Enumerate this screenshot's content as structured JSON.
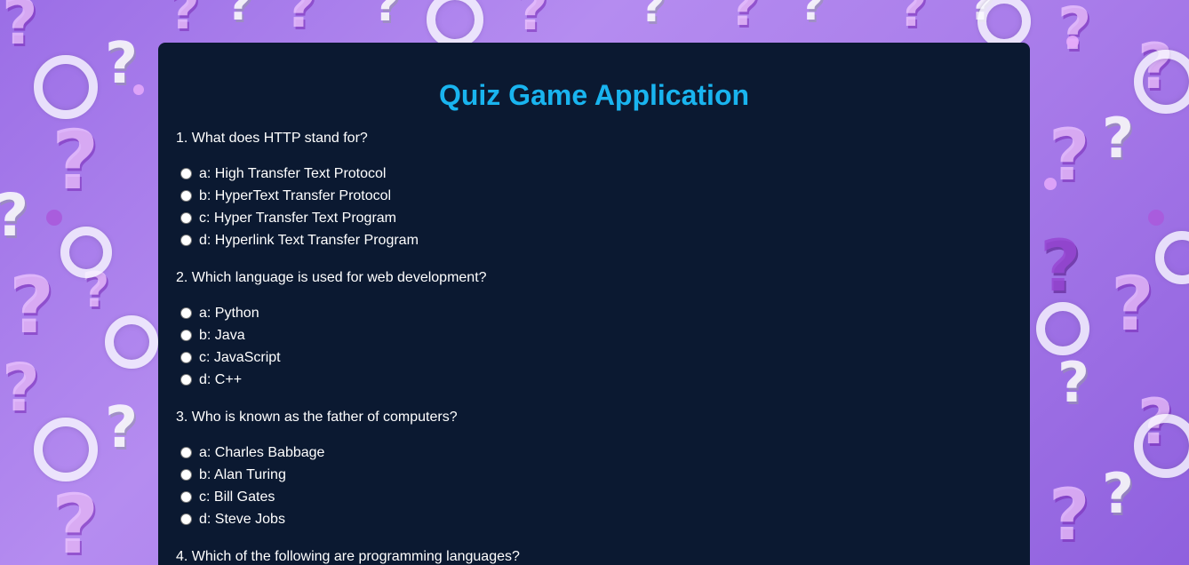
{
  "page": {
    "title": "Quiz Game Application",
    "title_color": "#19b4ef",
    "card_color": "#0b1931",
    "background_theme": "purple-question-marks"
  },
  "questions": [
    {
      "text": "1. What does HTTP stand for?",
      "options": [
        "a: High Transfer Text Protocol",
        "b: HyperText Transfer Protocol",
        "c: Hyper Transfer Text Program",
        "d: Hyperlink Text Transfer Program"
      ]
    },
    {
      "text": "2. Which language is used for web development?",
      "options": [
        "a: Python",
        "b: Java",
        "c: JavaScript",
        "d: C++"
      ]
    },
    {
      "text": "3. Who is known as the father of computers?",
      "options": [
        "a: Charles Babbage",
        "b: Alan Turing",
        "c: Bill Gates",
        "d: Steve Jobs"
      ]
    },
    {
      "text": "4. Which of the following are programming languages?",
      "options": []
    }
  ]
}
